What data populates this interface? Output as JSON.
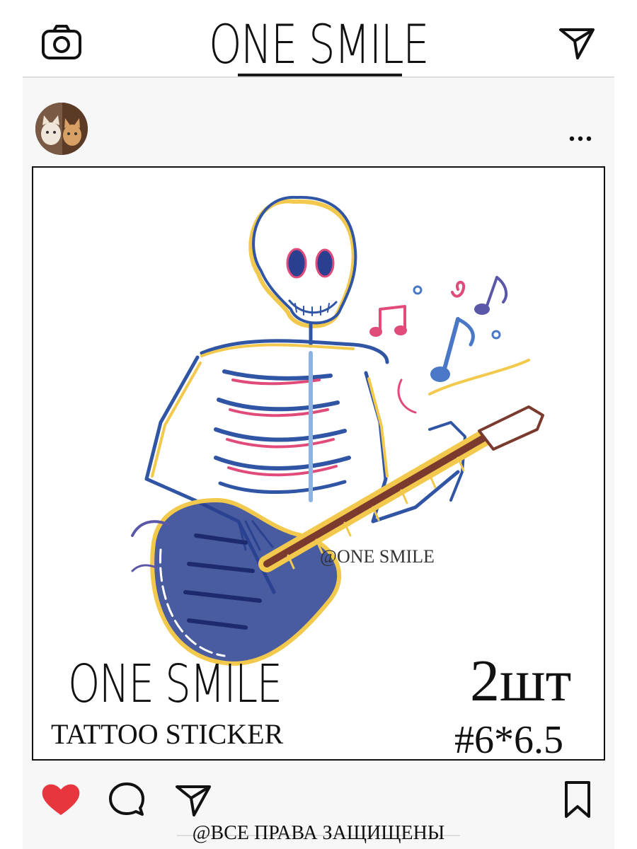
{
  "header": {
    "title": "ONE SMILE",
    "left_icon": "camera-icon",
    "right_icon": "send-icon"
  },
  "post": {
    "avatar_icon": "avatar-cats",
    "more_icon": "more-dots-icon",
    "watermark": "@ONE SMILE",
    "brand": "ONE SMILE",
    "subtitle": "TATTOO STICKER",
    "count": "2шт",
    "size": "#6*6.5"
  },
  "actions": {
    "like_icon": "heart-icon",
    "comment_icon": "comment-icon",
    "share_icon": "send-icon",
    "save_icon": "bookmark-icon",
    "like_color": "#e8363f"
  },
  "footer": {
    "text": "@ВСЕ ПРАВА ЗАЩИЩЕНЫ"
  }
}
